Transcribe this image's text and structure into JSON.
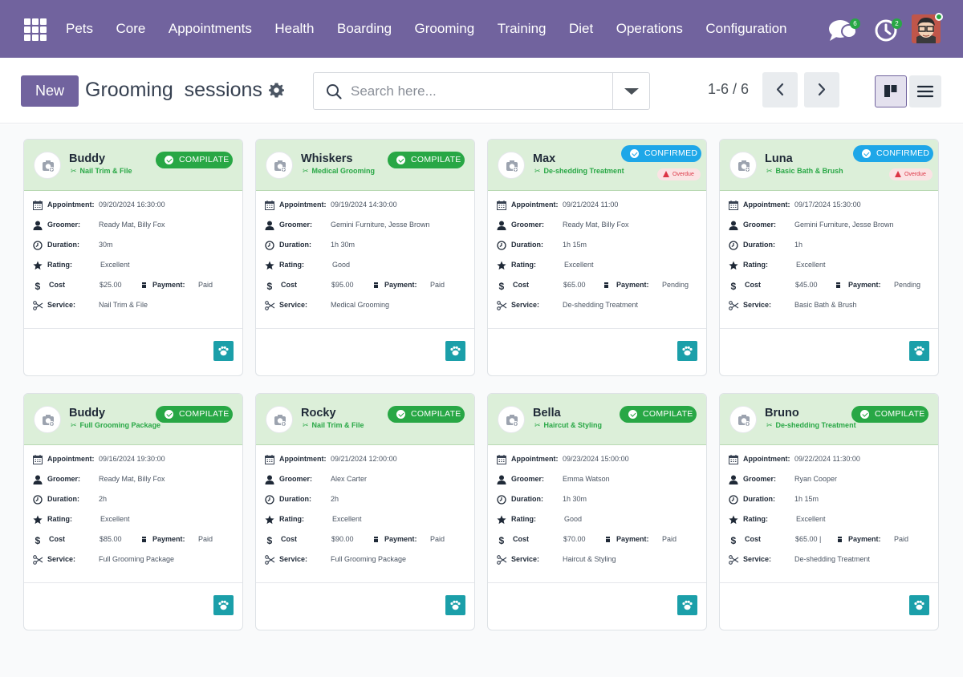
{
  "nav": {
    "menu": [
      "Pets",
      "Core",
      "Appointments",
      "Health",
      "Boarding",
      "Grooming",
      "Training",
      "Diet",
      "Operations",
      "Configuration"
    ],
    "messages_badge": "6",
    "activities_badge": "2"
  },
  "control_panel": {
    "new_label": "New",
    "title": "Grooming  sessions",
    "search_placeholder": "Search here...",
    "pager": "1-6 / 6"
  },
  "labels": {
    "appointment": "Appointment:",
    "groomer": "Groomer:",
    "duration": "Duration:",
    "rating": "Rating:",
    "cost": "Cost",
    "payment": "Payment:",
    "service": "Service:",
    "overdue": "Overdue"
  },
  "colors": {
    "brand": "#71639e",
    "compilate": "#28a745",
    "confirmed": "#1ea7e8",
    "header_bg": "#dcefd9",
    "paw_button": "#1b9fa9"
  },
  "cards": [
    {
      "pet": "Buddy",
      "service_tag": "Nail Trim & File",
      "status": "COMPILATE",
      "overdue": false,
      "appointment": "09/20/2024 16:30:00",
      "groomer": "Ready Mat, Billy Fox",
      "duration": "30m",
      "rating": "Excellent",
      "cost": "$25.00",
      "payment": "Paid",
      "service": "Nail Trim & File"
    },
    {
      "pet": "Whiskers",
      "service_tag": "Medical Grooming",
      "status": "COMPILATE",
      "overdue": false,
      "appointment": "09/19/2024 14:30:00",
      "groomer": "Gemini Furniture, Jesse Brown",
      "duration": "1h 30m",
      "rating": "Good",
      "cost": "$95.00",
      "payment": "Paid",
      "service": "Medical Grooming"
    },
    {
      "pet": "Max",
      "service_tag": "De-shedding Treatment",
      "status": "CONFIRMED",
      "overdue": true,
      "appointment": "09/21/2024 11:00",
      "groomer": "Ready Mat, Billy Fox",
      "duration": "1h 15m",
      "rating": "Excellent",
      "cost": "$65.00",
      "payment": "Pending",
      "service": "De-shedding Treatment"
    },
    {
      "pet": "Luna",
      "service_tag": "Basic Bath & Brush",
      "status": "CONFIRMED",
      "overdue": true,
      "appointment": "09/17/2024 15:30:00",
      "groomer": "Gemini Furniture, Jesse Brown",
      "duration": "1h",
      "rating": "Excellent",
      "cost": "$45.00",
      "payment": "Pending",
      "service": "Basic Bath & Brush"
    },
    {
      "pet": "Buddy",
      "service_tag": "Full Grooming Package",
      "status": "COMPILATE",
      "overdue": false,
      "appointment": "09/16/2024 19:30:00",
      "groomer": "Ready Mat, Billy Fox",
      "duration": "2h",
      "rating": "Excellent",
      "cost": "$85.00",
      "payment": "Paid",
      "service": "Full Grooming Package"
    },
    {
      "pet": "Rocky",
      "service_tag": "Nail Trim & File",
      "status": "COMPILATE",
      "overdue": false,
      "appointment": "09/21/2024 12:00:00",
      "groomer": "Alex Carter",
      "duration": "2h",
      "rating": "Excellent",
      "cost": "$90.00",
      "payment": "Paid",
      "service": "Full Grooming Package"
    },
    {
      "pet": "Bella",
      "service_tag": "Haircut & Styling",
      "status": "COMPILATE",
      "overdue": false,
      "appointment": "09/23/2024 15:00:00",
      "groomer": "Emma Watson",
      "duration": "1h 30m",
      "rating": "Good",
      "cost": "$70.00",
      "payment": "Paid",
      "service": "Haircut & Styling"
    },
    {
      "pet": "Bruno",
      "service_tag": "De-shedding Treatment",
      "status": "COMPILATE",
      "overdue": false,
      "appointment": "09/22/2024 11:30:00",
      "groomer": "Ryan Cooper",
      "duration": "1h 15m",
      "rating": "Excellent",
      "cost": "$65.00 |",
      "payment": "Paid",
      "service": "De-shedding Treatment"
    }
  ]
}
